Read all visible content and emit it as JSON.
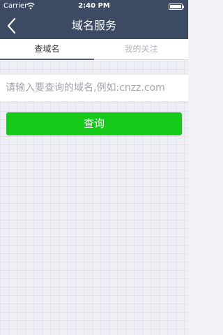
{
  "status_bar": {
    "carrier": "Carrier",
    "time": "2:40 PM"
  },
  "nav": {
    "title": "域名服务",
    "back_icon": "chevron-left-icon"
  },
  "tabs": [
    {
      "label": "查域名",
      "active": true
    },
    {
      "label": "我的关注",
      "active": false
    }
  ],
  "search": {
    "placeholder": "请输入要查询的域名,例如:cnzz.com",
    "value": ""
  },
  "query_button": {
    "label": "查询"
  },
  "colors": {
    "nav_bg": "#3d4a63",
    "button_green": "#16c91a",
    "page_bg": "#eef0f5"
  }
}
